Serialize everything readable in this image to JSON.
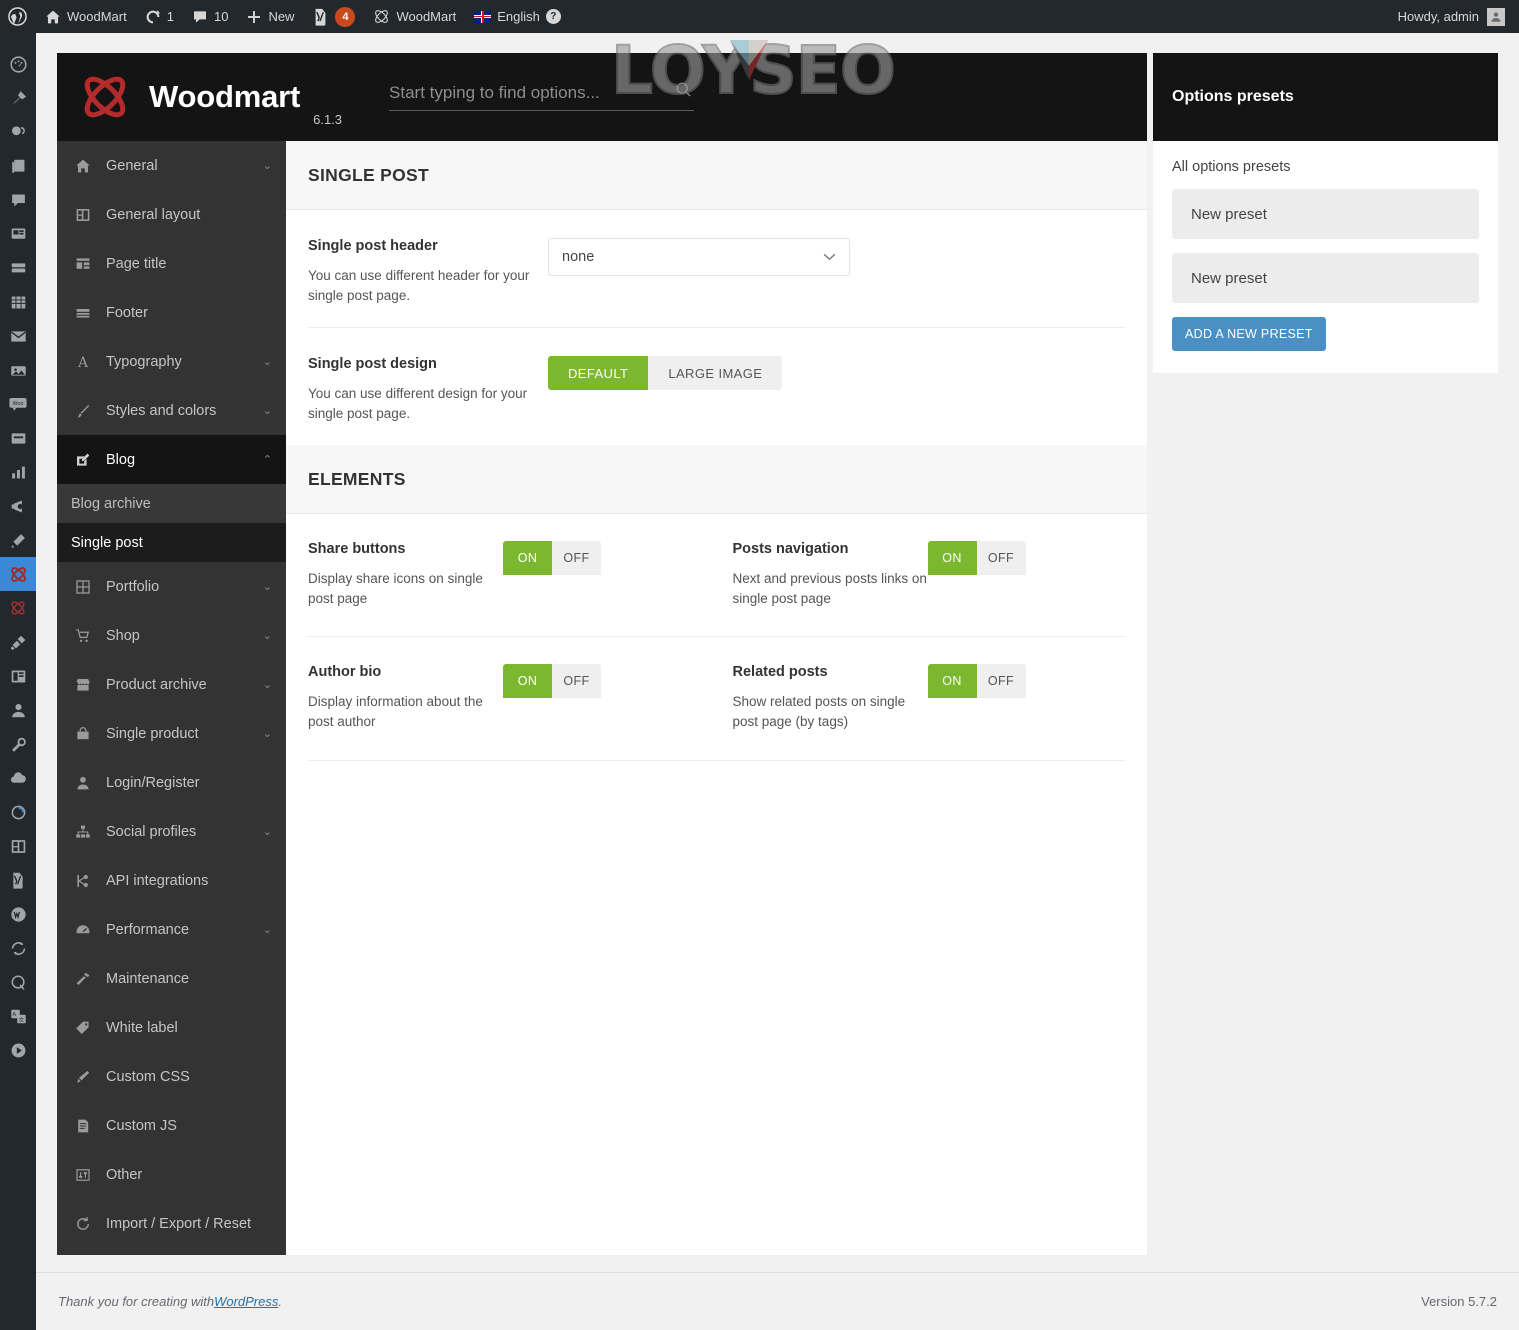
{
  "adminbar": {
    "items": [
      {
        "icon": "wordpress-logo-icon",
        "label": ""
      },
      {
        "icon": "home-icon",
        "label": "WoodMart"
      },
      {
        "icon": "updates-icon",
        "label": "1"
      },
      {
        "icon": "comments-icon",
        "label": "10"
      },
      {
        "icon": "plus-icon",
        "label": "New"
      },
      {
        "icon": "yoast-icon",
        "label": "",
        "badge": "4"
      },
      {
        "icon": "woodmart-icon",
        "label": "WoodMart"
      },
      {
        "icon": "uk-flag-icon",
        "label": "English",
        "help": "?"
      }
    ],
    "howdy": "Howdy, admin"
  },
  "wp_menu": {
    "items": [
      {
        "name": "dashboard-icon"
      },
      {
        "name": "posts-icon"
      },
      {
        "name": "media-icon"
      },
      {
        "name": "pages-icon"
      },
      {
        "name": "comments-icon"
      },
      {
        "name": "portfolio-icon"
      },
      {
        "name": "slider-icon"
      },
      {
        "name": "tables-icon"
      },
      {
        "name": "mail-icon"
      },
      {
        "name": "gallery-icon"
      },
      {
        "name": "woo-icon"
      },
      {
        "name": "products-icon"
      },
      {
        "name": "analytics-icon"
      },
      {
        "name": "marketing-icon"
      },
      {
        "name": "elementor-icon"
      },
      {
        "name": "woodmart-icon"
      },
      {
        "name": "woodmart-theme-icon"
      },
      {
        "name": "plugins-icon"
      },
      {
        "name": "appearance-icon"
      },
      {
        "name": "users-icon"
      },
      {
        "name": "tools-icon"
      },
      {
        "name": "cloud-icon"
      },
      {
        "name": "updraft-icon"
      },
      {
        "name": "layout-icon"
      },
      {
        "name": "yoast-icon"
      },
      {
        "name": "wpml-icon"
      },
      {
        "name": "sync-icon"
      },
      {
        "name": "support-icon"
      },
      {
        "name": "translate-icon"
      },
      {
        "name": "video-icon"
      }
    ]
  },
  "watermark": {
    "text": "LOYSEO"
  },
  "theme_panel": {
    "title": "Woodmart",
    "version": "6.1.3",
    "search_placeholder": "Start typing to find options...",
    "search_value": ""
  },
  "nav": {
    "items": [
      {
        "label": "General",
        "icon": "home-icon",
        "chevron": "down",
        "active": false
      },
      {
        "label": "General layout",
        "icon": "layout-icon",
        "chevron": "",
        "active": false
      },
      {
        "label": "Page title",
        "icon": "page-title-icon",
        "chevron": "",
        "active": false
      },
      {
        "label": "Footer",
        "icon": "footer-icon",
        "chevron": "",
        "active": false
      },
      {
        "label": "Typography",
        "icon": "typography-icon",
        "chevron": "down",
        "active": false
      },
      {
        "label": "Styles and colors",
        "icon": "brush-icon",
        "chevron": "down",
        "active": false
      },
      {
        "label": "Blog",
        "icon": "blog-icon",
        "chevron": "up",
        "active": true
      },
      {
        "label": "Portfolio",
        "icon": "portfolio-icon",
        "chevron": "down",
        "active": false
      },
      {
        "label": "Shop",
        "icon": "cart-icon",
        "chevron": "down",
        "active": false
      },
      {
        "label": "Product archive",
        "icon": "shop-icon",
        "chevron": "down",
        "active": false
      },
      {
        "label": "Single product",
        "icon": "bag-icon",
        "chevron": "down",
        "active": false
      },
      {
        "label": "Login/Register",
        "icon": "user-icon",
        "chevron": "",
        "active": false
      },
      {
        "label": "Social profiles",
        "icon": "social-icon",
        "chevron": "down",
        "active": false
      },
      {
        "label": "API integrations",
        "icon": "api-icon",
        "chevron": "",
        "active": false
      },
      {
        "label": "Performance",
        "icon": "performance-icon",
        "chevron": "down",
        "active": false
      },
      {
        "label": "Maintenance",
        "icon": "maintenance-icon",
        "chevron": "",
        "active": false
      },
      {
        "label": "White label",
        "icon": "tag-icon",
        "chevron": "",
        "active": false
      },
      {
        "label": "Custom CSS",
        "icon": "css-icon",
        "chevron": "",
        "active": false
      },
      {
        "label": "Custom JS",
        "icon": "js-icon",
        "chevron": "",
        "active": false
      },
      {
        "label": "Other",
        "icon": "other-icon",
        "chevron": "",
        "active": false
      },
      {
        "label": "Import / Export / Reset",
        "icon": "reset-icon",
        "chevron": "",
        "active": false
      }
    ],
    "sub_items": [
      {
        "label": "Blog archive",
        "selected": false
      },
      {
        "label": "Single post",
        "selected": true
      }
    ]
  },
  "sections": {
    "single_post": {
      "heading": "SINGLE POST",
      "fields": [
        {
          "title": "Single post header",
          "desc": "You can use different header for your single post page.",
          "control": "select",
          "value": "none"
        },
        {
          "title": "Single post design",
          "desc": "You can use different design for your single post page.",
          "control": "buttongroup",
          "options": [
            "DEFAULT",
            "LARGE IMAGE"
          ],
          "selected": "DEFAULT"
        }
      ]
    },
    "elements": {
      "heading": "ELEMENTS",
      "toggle_on_label": "ON",
      "toggle_off_label": "OFF",
      "items": [
        {
          "title": "Share buttons",
          "desc": "Display share icons on single post page",
          "value": "ON"
        },
        {
          "title": "Posts navigation",
          "desc": "Next and previous posts links on single post page",
          "value": "ON"
        },
        {
          "title": "Author bio",
          "desc": "Display information about the post author",
          "value": "ON"
        },
        {
          "title": "Related posts",
          "desc": "Show related posts on single post page (by tags)",
          "value": "ON"
        }
      ]
    }
  },
  "presets": {
    "header": "Options presets",
    "label": "All options presets",
    "items": [
      {
        "label": "New preset"
      },
      {
        "label": "New preset"
      }
    ],
    "add_button": "ADD A NEW PRESET"
  },
  "footer": {
    "thanks_prefix": "Thank you for creating with ",
    "link": "WordPress",
    "thanks_suffix": ".",
    "version": "Version 5.7.2"
  },
  "colors": {
    "accent_green": "#7cb82f",
    "accent_blue": "#4a90c4",
    "badge_red": "#ca4a1f",
    "dark": "#141414",
    "nav_bg": "#333333"
  }
}
